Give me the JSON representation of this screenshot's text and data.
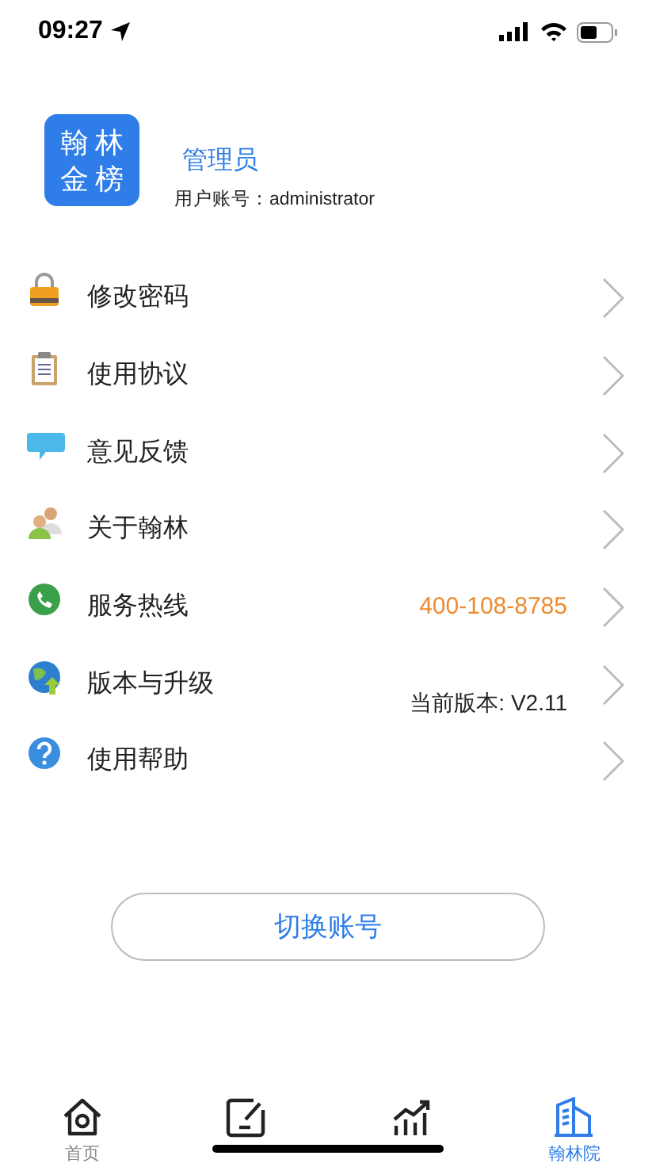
{
  "status_bar": {
    "time": "09:27"
  },
  "profile": {
    "logo": [
      "翰",
      "林",
      "金",
      "榜"
    ],
    "name": "管理员",
    "account": "用户账号：administrator"
  },
  "menu": [
    {
      "label": "修改密码",
      "kind": "plain"
    },
    {
      "label": "使用协议",
      "kind": "plain"
    },
    {
      "label": "意见反馈",
      "kind": "plain"
    },
    {
      "label": "关于翰林",
      "kind": "plain"
    },
    {
      "label": "服务热线",
      "value": "400-108-8785",
      "kind": "phone"
    },
    {
      "label": "版本与升级",
      "value": "当前版本: V2.11",
      "kind": "version"
    },
    {
      "label": "使用帮助",
      "kind": "plain"
    }
  ],
  "switch_button": "切换账号",
  "tabs": [
    {
      "label": "首页",
      "selected": false
    },
    {
      "selected": false
    },
    {
      "selected": false
    },
    {
      "label": "翰林院",
      "selected": true
    }
  ]
}
